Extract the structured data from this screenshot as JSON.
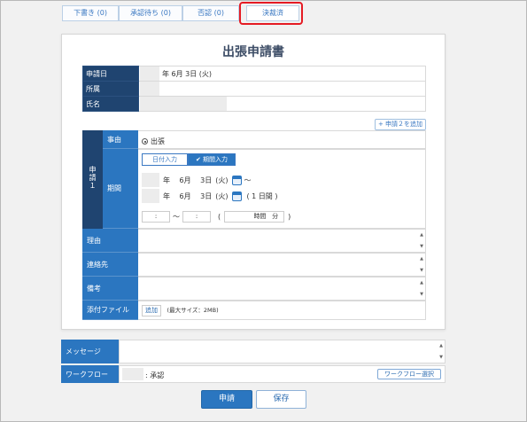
{
  "tabs": [
    {
      "label": "下書き (0)"
    },
    {
      "label": "承認待ち (0)"
    },
    {
      "label": "否認 (0)"
    },
    {
      "label": "決裁済"
    }
  ],
  "form": {
    "title": "出張申請書",
    "application_date": {
      "label": "申請日",
      "value": "年 6月 3日 (火)"
    },
    "department": {
      "label": "所属",
      "value": ""
    },
    "name": {
      "label": "氏名",
      "value": ""
    },
    "add_application_label": "+ 申請２を追加",
    "application": {
      "label": "申請１",
      "purpose": {
        "label": "事由",
        "option": "出張"
      },
      "period": {
        "label": "期間",
        "toggle_date": "日付入力",
        "toggle_period": "期間入力",
        "start": {
          "month_text": "年　 6月　 3日",
          "weekday": "(火)",
          "tilde": "〜"
        },
        "end": {
          "month_text": "年　 6月　 3日",
          "weekday": "(火)",
          "duration": "( 1 日間 )"
        },
        "time_from": ":",
        "time_to": ":",
        "time_tilde": "〜",
        "open_paren": "(",
        "time_hours": "時間",
        "time_minutes": "分",
        "close_paren": ")"
      }
    },
    "reason": {
      "label": "理由"
    },
    "contact": {
      "label": "連絡先"
    },
    "remarks": {
      "label": "備考"
    },
    "attachment": {
      "label": "添付ファイル",
      "button": "追加",
      "note": "(最大サイズ：2MB)"
    }
  },
  "message": {
    "label": "メッセージ"
  },
  "workflow": {
    "label": "ワークフロー",
    "value": ": 承認",
    "select_button": "ワークフロー選択"
  },
  "actions": {
    "submit": "申請",
    "save": "保存"
  },
  "colors": {
    "header_dark": "#1f4470",
    "header_blue": "#2b76c0",
    "highlight": "#e51b24"
  }
}
